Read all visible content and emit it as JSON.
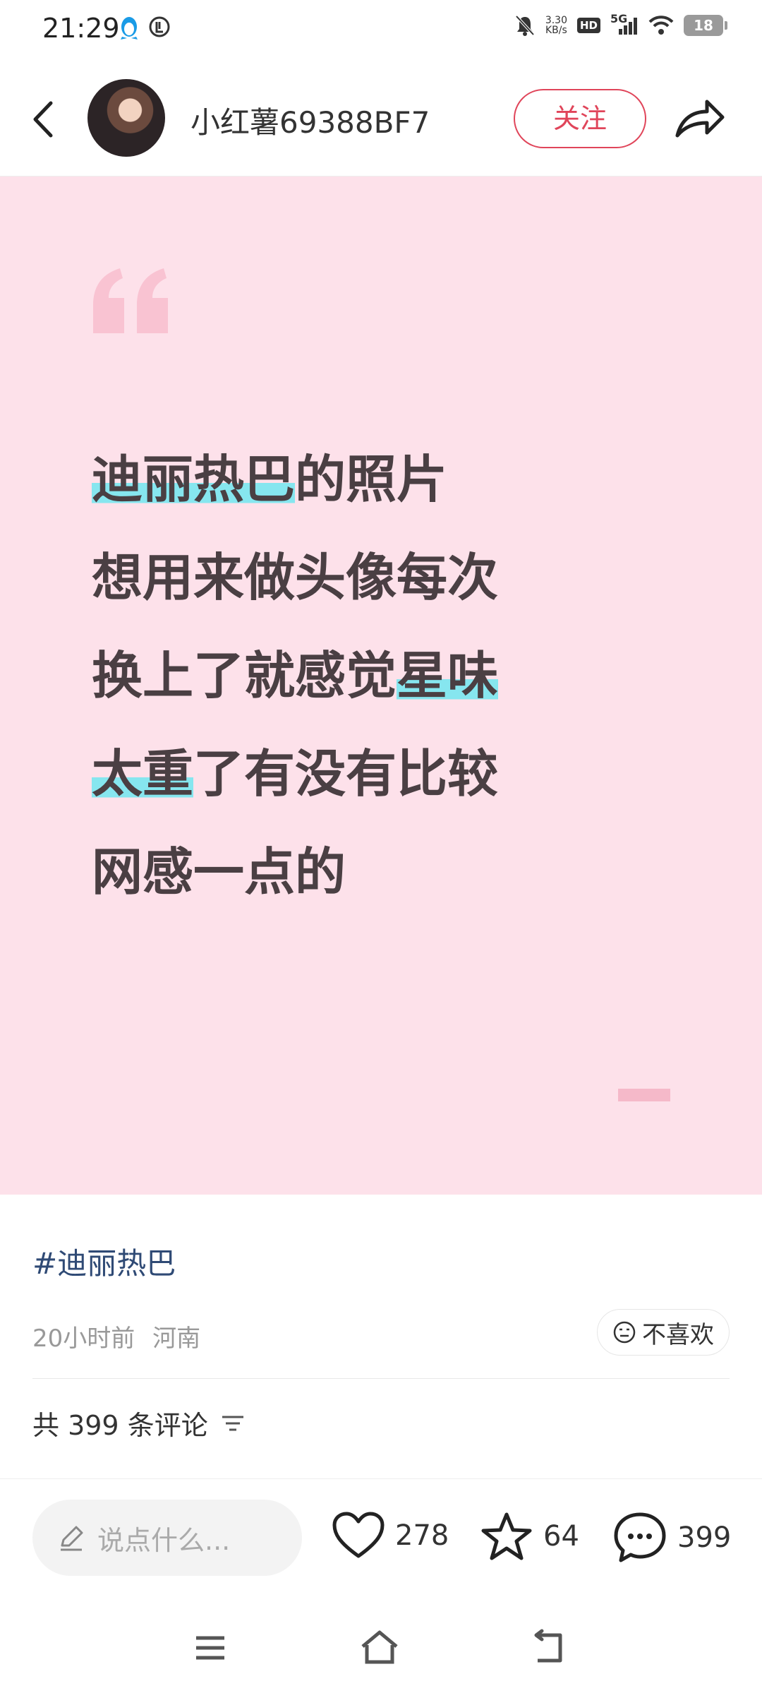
{
  "status_bar": {
    "time": "21:29",
    "net_speed_value": "3.30",
    "net_speed_unit": "KB/s",
    "hd_label": "HD",
    "network_label": "5G",
    "battery": "18",
    "icons": [
      "qq-penguin-icon",
      "notification-icon",
      "mute-icon",
      "signal-icon",
      "wifi-icon",
      "battery-icon"
    ]
  },
  "header": {
    "username": "小红薯69388BF7",
    "follow_label": "关注",
    "colors": {
      "accent": "#e0455a"
    }
  },
  "post": {
    "card_color": "#fde1ea",
    "highlight_color": "#86e6ef",
    "lines": [
      [
        {
          "t": "迪丽热巴",
          "hl": true
        },
        {
          "t": "的照片",
          "hl": false
        }
      ],
      [
        {
          "t": "想用来做头像每次",
          "hl": false
        }
      ],
      [
        {
          "t": "换上了就感觉",
          "hl": false
        },
        {
          "t": "星味",
          "hl": true
        }
      ],
      [
        {
          "t": "太重",
          "hl": true
        },
        {
          "t": "了有没有比较",
          "hl": false
        }
      ],
      [
        {
          "t": "网感一点的",
          "hl": false
        }
      ]
    ],
    "hashtag": "#迪丽热巴",
    "time_ago": "20小时前",
    "location": "河南",
    "dislike_label": "不喜欢"
  },
  "comments": {
    "summary": "共 399 条评论"
  },
  "bottom_bar": {
    "input_placeholder": "说点什么...",
    "likes": "278",
    "favorites": "64",
    "comments": "399"
  },
  "nav": {
    "icons": [
      "menu-icon",
      "home-icon",
      "back-nav-icon"
    ]
  }
}
